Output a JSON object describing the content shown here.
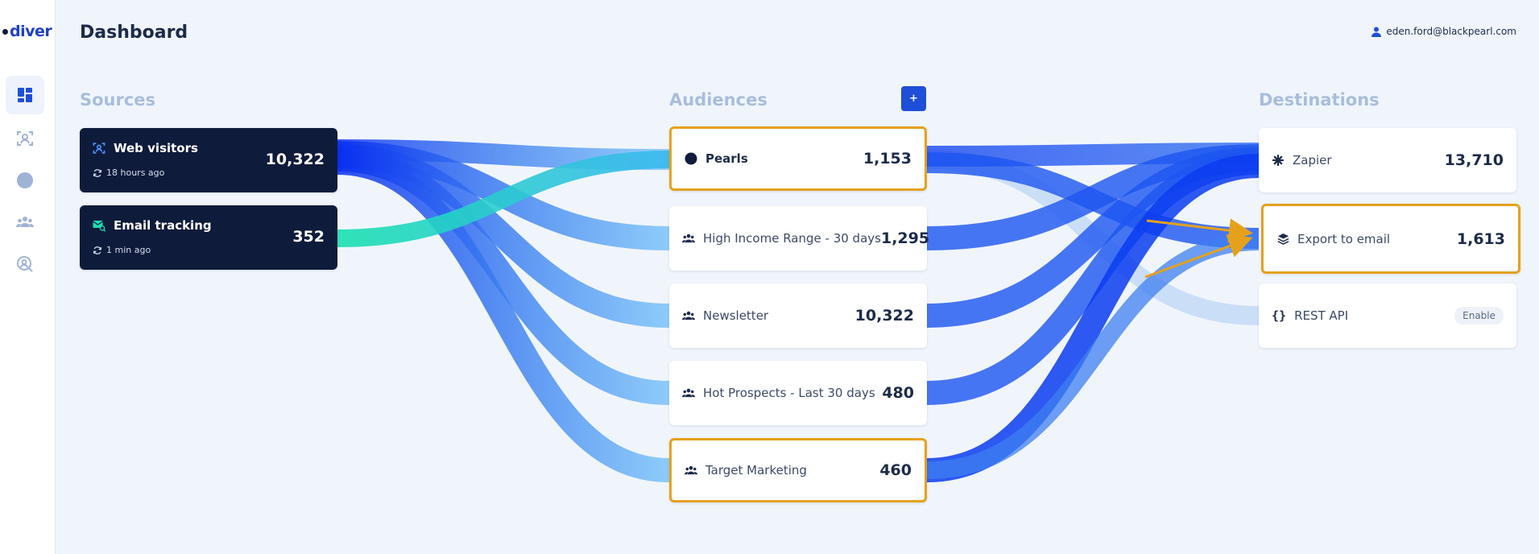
{
  "app": {
    "logo_text": "diver"
  },
  "header": {
    "title": "Dashboard",
    "user_email": "eden.ford@blackpearl.com"
  },
  "sidebar": {
    "items": [
      {
        "name": "dashboard",
        "icon": "dashboard-icon",
        "active": true
      },
      {
        "name": "sources",
        "icon": "scan-user-icon",
        "active": false
      },
      {
        "name": "pearls",
        "icon": "circle-icon",
        "active": false
      },
      {
        "name": "audiences",
        "icon": "group-icon",
        "active": false
      },
      {
        "name": "search",
        "icon": "search-user-icon",
        "active": false
      }
    ]
  },
  "columns": {
    "sources": "Sources",
    "audiences": "Audiences",
    "destinations": "Destinations",
    "add_label": "+"
  },
  "sources": [
    {
      "name": "Web visitors",
      "time": "18 hours ago",
      "value": "10,322",
      "icon": "scan-user-icon"
    },
    {
      "name": "Email tracking",
      "time": "1 min ago",
      "value": "352",
      "icon": "mail-search-icon"
    }
  ],
  "audiences": [
    {
      "name": "Pearls",
      "value": "1,153",
      "icon": "pearl-icon",
      "highlighted": true
    },
    {
      "name": "High Income Range - 30 days",
      "value": "1,295",
      "icon": "group-icon"
    },
    {
      "name": "Newsletter",
      "value": "10,322",
      "icon": "group-icon"
    },
    {
      "name": "Hot Prospects - Last 30 days",
      "value": "480",
      "icon": "group-icon"
    },
    {
      "name": "Target Marketing",
      "value": "460",
      "icon": "group-icon",
      "highlighted": true
    }
  ],
  "destinations": [
    {
      "name": "Zapier",
      "value": "13,710",
      "icon": "zapier-icon"
    },
    {
      "name": "Export to email",
      "value": "1,613",
      "icon": "layers-icon",
      "highlighted": true
    },
    {
      "name": "REST API",
      "action": "Enable",
      "icon": "braces-icon"
    }
  ],
  "colors": {
    "accent": "#1e4fd8",
    "flow_dark": "#0a3cf0",
    "flow_mid": "#3d7ff0",
    "flow_light": "#7cc4fa",
    "flow_teal": "#19e0b0",
    "highlight": "#e6a11c",
    "dark_card": "#0e1b3a"
  }
}
